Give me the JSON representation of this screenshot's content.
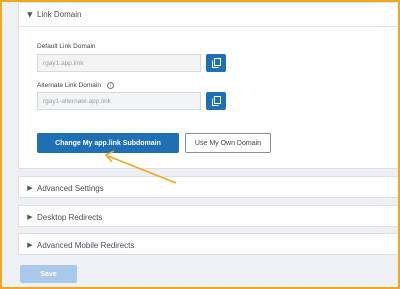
{
  "link_domain": {
    "title": "Link Domain",
    "default_label": "Default Link Domain",
    "default_value": "rgay1.app.link",
    "alternate_label": "Alternate Link Domain",
    "alternate_value": "rgay1-alternate.app.link",
    "info_icon": "info-icon",
    "copy_icon": "copy-icon"
  },
  "buttons": {
    "change_subdomain": "Change My app.link Subdomain",
    "use_own_domain": "Use My Own Domain",
    "save": "Save"
  },
  "sections": {
    "advanced_settings": "Advanced Settings",
    "desktop_redirects": "Desktop Redirects",
    "advanced_mobile_redirects": "Advanced Mobile Redirects"
  },
  "colors": {
    "accent": "#1f6fb5",
    "highlight": "#f0a81c",
    "save_disabled": "#a9c9ea"
  }
}
